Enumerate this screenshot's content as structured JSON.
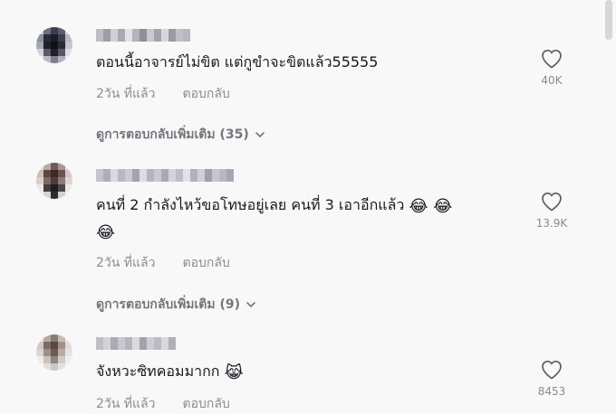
{
  "comments": [
    {
      "text": "ตอนนี้อาจารย์ไม่ขิต แต่กูขำจะขิตแล้ว55555",
      "time": "2วัน ที่แล้ว",
      "reply_label": "ตอบกลับ",
      "likes": "40K",
      "more_replies": "ดูการตอบกลับเพิ่มเติม (35)"
    },
    {
      "text": "คนที่ 2 กำลังไหว้ขอโทษอยู่เลย คนที่ 3 เอาอีกแล้ว",
      "emoji_line1": "😂 😂",
      "emoji_line2": "😂",
      "time": "2วัน ที่แล้ว",
      "reply_label": "ตอบกลับ",
      "likes": "13.9K",
      "more_replies": "ดูการตอบกลับเพิ่มเติม (9)"
    },
    {
      "text": "จังหวะซิทคอมมากก",
      "emoji": "😹",
      "time": "2วัน ที่แล้ว",
      "reply_label": "ตอบกลับ",
      "likes": "8453"
    }
  ],
  "icons": {
    "heart": "heart-outline-icon",
    "chevron": "chevron-down-icon"
  },
  "colors": {
    "background": "#f8f8f8",
    "text": "#161823",
    "secondary": "#8a8b91"
  }
}
